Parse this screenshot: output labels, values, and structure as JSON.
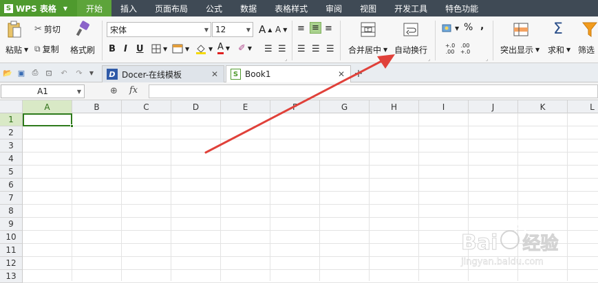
{
  "app": {
    "title": "WPS 表格",
    "logo_letter": "S"
  },
  "menu": {
    "tabs": [
      "开始",
      "插入",
      "页面布局",
      "公式",
      "数据",
      "表格样式",
      "审阅",
      "视图",
      "开发工具",
      "特色功能"
    ],
    "active": "开始"
  },
  "ribbon": {
    "paste": "粘贴",
    "cut": "剪切",
    "copy": "复制",
    "format_painter": "格式刷",
    "font_name": "宋体",
    "font_size": "12",
    "bold": "B",
    "italic": "I",
    "underline": "U",
    "font_color_glyph": "A",
    "grow_font": "A",
    "shrink_font": "A",
    "merge_center": "合并居中",
    "wrap_text": "自动换行",
    "percent": "%",
    "comma": ",",
    "inc_decimal": "+.0 .00",
    "dec_decimal": ".00 +.0",
    "highlight": "突出显示",
    "sum_symbol": "Σ",
    "sum": "求和",
    "filter": "筛选"
  },
  "tabs_bar": {
    "documents": [
      {
        "name": "Docer-在线模板",
        "icon_letter": "D"
      },
      {
        "name": "Book1",
        "icon_letter": "S"
      }
    ],
    "new_tab": "+"
  },
  "formula_bar": {
    "name_box": "A1",
    "fx": "fx",
    "value": ""
  },
  "sheet": {
    "columns": [
      "A",
      "B",
      "C",
      "D",
      "E",
      "F",
      "G",
      "H",
      "I",
      "J",
      "K",
      "L"
    ],
    "rows": [
      "1",
      "2",
      "3",
      "4",
      "5",
      "6",
      "7",
      "8",
      "9",
      "10",
      "11",
      "12",
      "13"
    ],
    "active_cell": "A1"
  },
  "colors": {
    "accent": "#5da43a",
    "menu_bg": "#3f4a55",
    "arrow": "#e0413a"
  },
  "watermark": {
    "brand": "Bai",
    "brand_cn": "经验",
    "url": "jingyan.baidu.com"
  }
}
